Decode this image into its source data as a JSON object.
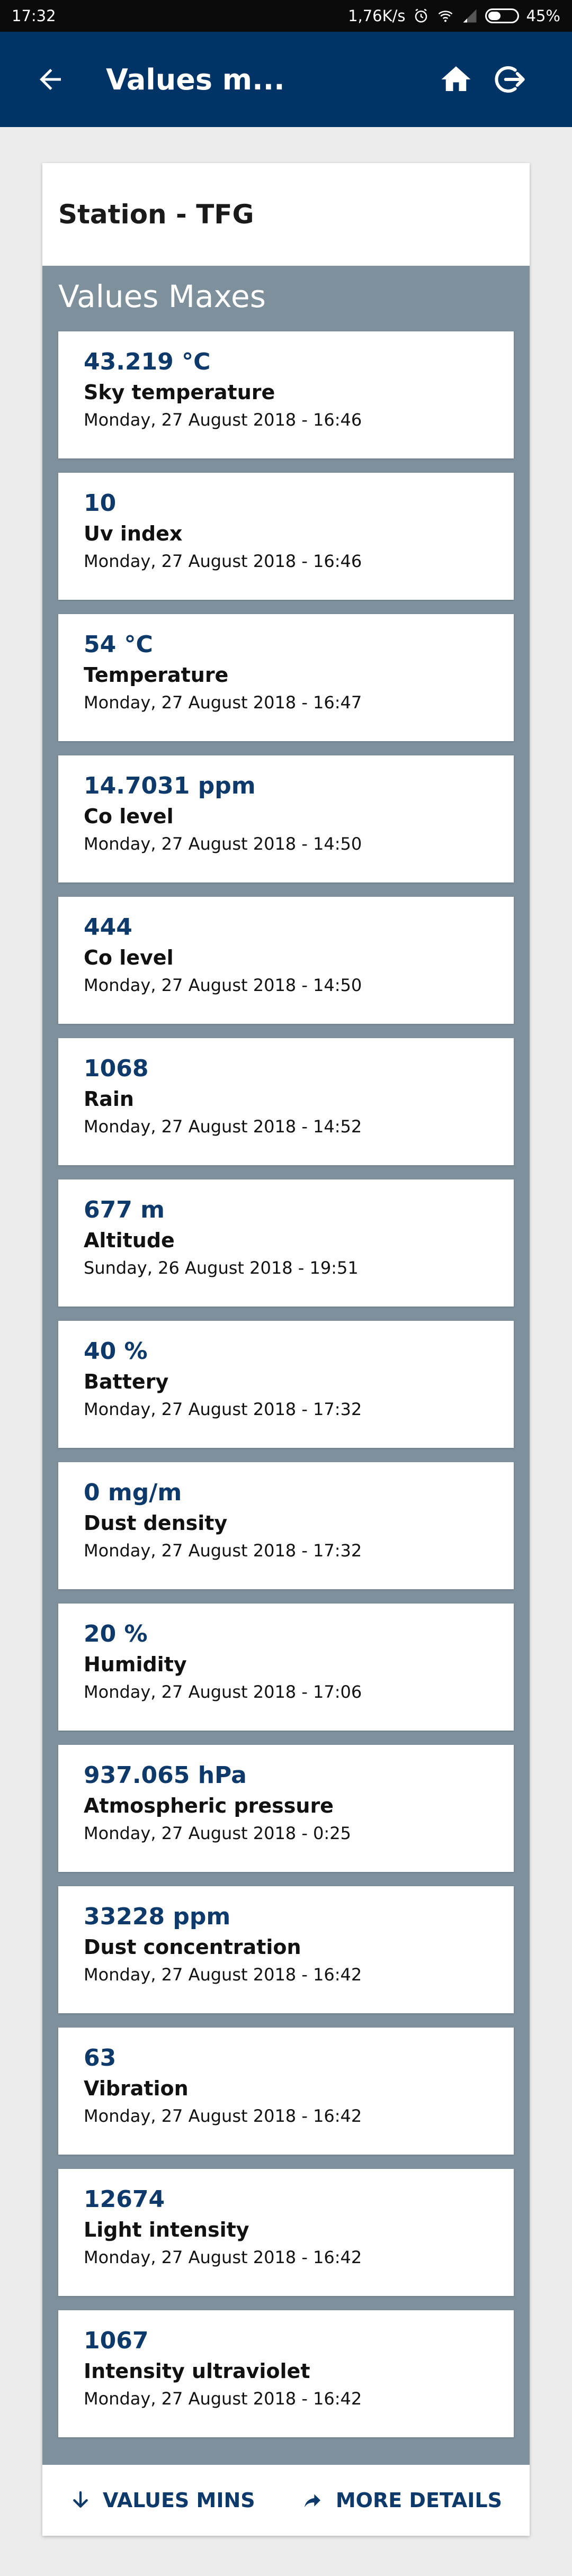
{
  "status_bar": {
    "time": "17:32",
    "network_speed": "1,76K/s",
    "battery": "45%",
    "battery_level": 0.45
  },
  "app_bar": {
    "title": "Values m...",
    "color": "#003466"
  },
  "station": {
    "name": "Station - TFG"
  },
  "section": {
    "title": "Values Maxes",
    "background": "#7d909c"
  },
  "values": [
    {
      "value": "43.219 °C",
      "label": "Sky temperature",
      "date": "Monday, 27 August 2018 - 16:46"
    },
    {
      "value": "10",
      "label": "Uv index",
      "date": "Monday, 27 August 2018 - 16:46"
    },
    {
      "value": "54 °C",
      "label": "Temperature",
      "date": "Monday, 27 August 2018 - 16:47"
    },
    {
      "value": "14.7031 ppm",
      "label": "Co level",
      "date": "Monday, 27 August 2018 - 14:50"
    },
    {
      "value": "444",
      "label": "Co level",
      "date": "Monday, 27 August 2018 - 14:50"
    },
    {
      "value": "1068",
      "label": "Rain",
      "date": "Monday, 27 August 2018 - 14:52"
    },
    {
      "value": "677 m",
      "label": "Altitude",
      "date": "Sunday, 26 August 2018 - 19:51"
    },
    {
      "value": "40 %",
      "label": "Battery",
      "date": "Monday, 27 August 2018 - 17:32"
    },
    {
      "value": "0 mg/m",
      "label": "Dust density",
      "date": "Monday, 27 August 2018 - 17:32"
    },
    {
      "value": "20 %",
      "label": "Humidity",
      "date": "Monday, 27 August 2018 - 17:06"
    },
    {
      "value": "937.065 hPa",
      "label": "Atmospheric pressure",
      "date": "Monday, 27 August 2018 - 0:25"
    },
    {
      "value": "33228 ppm",
      "label": "Dust concentration",
      "date": "Monday, 27 August 2018 - 16:42"
    },
    {
      "value": "63",
      "label": "Vibration",
      "date": "Monday, 27 August 2018 - 16:42"
    },
    {
      "value": "12674",
      "label": "Light intensity",
      "date": "Monday, 27 August 2018 - 16:42"
    },
    {
      "value": "1067",
      "label": "Intensity ultraviolet",
      "date": "Monday, 27 August 2018 - 16:42"
    }
  ],
  "footer": {
    "values_mins_label": "VALUES MINS",
    "more_details_label": "MORE DETAILS",
    "values_mins_icon": "arrow-down-icon",
    "more_details_icon": "share-arrow-icon"
  }
}
